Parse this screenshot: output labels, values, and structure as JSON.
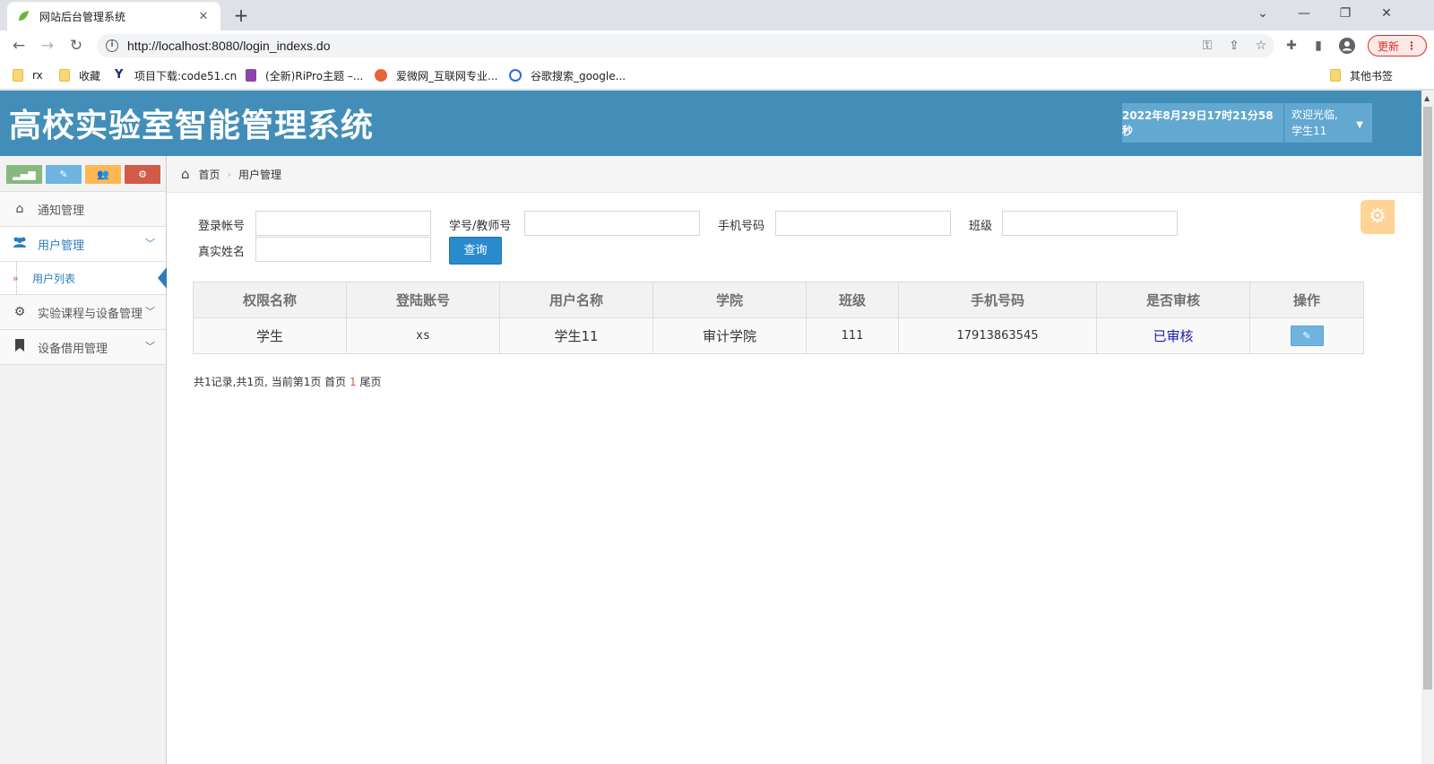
{
  "browser": {
    "tab_title": "网站后台管理系统",
    "tab_close": "✕",
    "new_tab": "+",
    "url": "http://localhost:8080/login_indexs.do",
    "update_label": "更新",
    "bookmarks": [
      {
        "label": "rx",
        "icon": "folder-icon"
      },
      {
        "label": "收藏",
        "icon": "folder-icon"
      },
      {
        "label": "项目下载:code51.cn",
        "icon": "site-icon"
      },
      {
        "label": "(全新)RiPro主题 –...",
        "icon": "site-icon"
      },
      {
        "label": "爱微网_互联网专业...",
        "icon": "site-icon"
      },
      {
        "label": "谷歌搜索_google...",
        "icon": "site-icon"
      }
    ],
    "other_bookmarks": "其他书签"
  },
  "header": {
    "title": "高校实验室智能管理系统",
    "datetime": "2022年8月29日17时21分58秒",
    "welcome": "欢迎光临,",
    "username": "学生11"
  },
  "sidebar": {
    "items": [
      {
        "label": "通知管理",
        "icon": "home-icon"
      },
      {
        "label": "用户管理",
        "icon": "users-icon"
      },
      {
        "label": "用户列表",
        "icon": "double-chevron-icon"
      },
      {
        "label": "实验课程与设备管理",
        "icon": "cogs-icon"
      },
      {
        "label": "设备借用管理",
        "icon": "bookmark-icon"
      }
    ]
  },
  "breadcrumb": {
    "home": "首页",
    "current": "用户管理"
  },
  "search_form": {
    "login_account_label": "登录帐号",
    "student_no_label": "学号/教师号",
    "phone_label": "手机号码",
    "class_label": "班级",
    "real_name_label": "真实姓名",
    "query_label": "查询"
  },
  "table": {
    "headers": [
      "权限名称",
      "登陆账号",
      "用户名称",
      "学院",
      "班级",
      "手机号码",
      "是否审核",
      "操作"
    ],
    "rows": [
      {
        "role": "学生",
        "account": "xs",
        "name": "学生11",
        "college": "审计学院",
        "class": "111",
        "phone": "17913863545",
        "status": "已审核"
      }
    ]
  },
  "pager": {
    "summary": "共1记录,共1页, 当前第1页 首页",
    "current_page": "1",
    "last": "尾页"
  },
  "colors": {
    "header_bg": "#438eb9",
    "accent_blue": "#2b7dbc",
    "status_blue": "#1c1ca3"
  }
}
